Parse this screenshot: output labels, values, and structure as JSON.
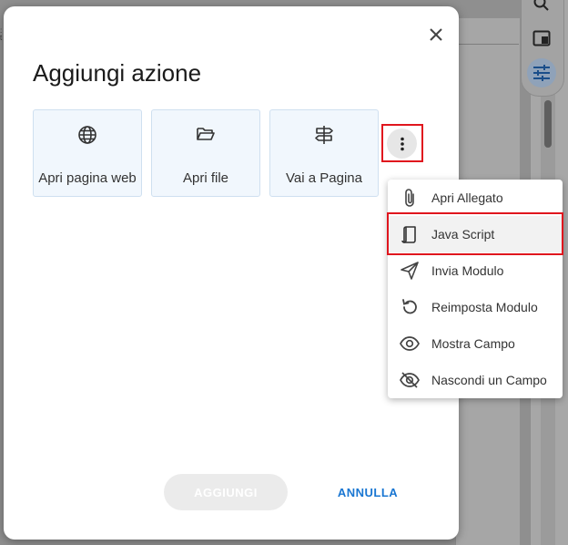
{
  "dialog": {
    "title": "Aggiungi azione",
    "close_icon": "close-icon",
    "cards": [
      {
        "label": "Apri pagina web",
        "icon": "globe-icon"
      },
      {
        "label": "Apri file",
        "icon": "folder-open-icon"
      },
      {
        "label": "Vai a Pagina",
        "icon": "signpost-icon"
      }
    ],
    "more_icon": "more-vertical-icon",
    "add_label": "AGGIUNGI",
    "cancel_label": "ANNULLA"
  },
  "menu": {
    "items": [
      {
        "label": "Apri Allegato",
        "icon": "paperclip-icon"
      },
      {
        "label": "Java Script",
        "icon": "script-icon"
      },
      {
        "label": "Invia Modulo",
        "icon": "send-icon"
      },
      {
        "label": "Reimposta Modulo",
        "icon": "reset-icon"
      },
      {
        "label": "Mostra Campo",
        "icon": "eye-icon"
      },
      {
        "label": "Nascondi un Campo",
        "icon": "eye-off-icon"
      }
    ],
    "highlighted_item": "Java Script"
  },
  "right_rail": {
    "icons": [
      "search-icon",
      "panel-icon",
      "sliders-icon"
    ]
  },
  "colors": {
    "accent": "#1976d2",
    "highlight_border": "#e0161e",
    "card_bg": "#f1f7fd"
  }
}
